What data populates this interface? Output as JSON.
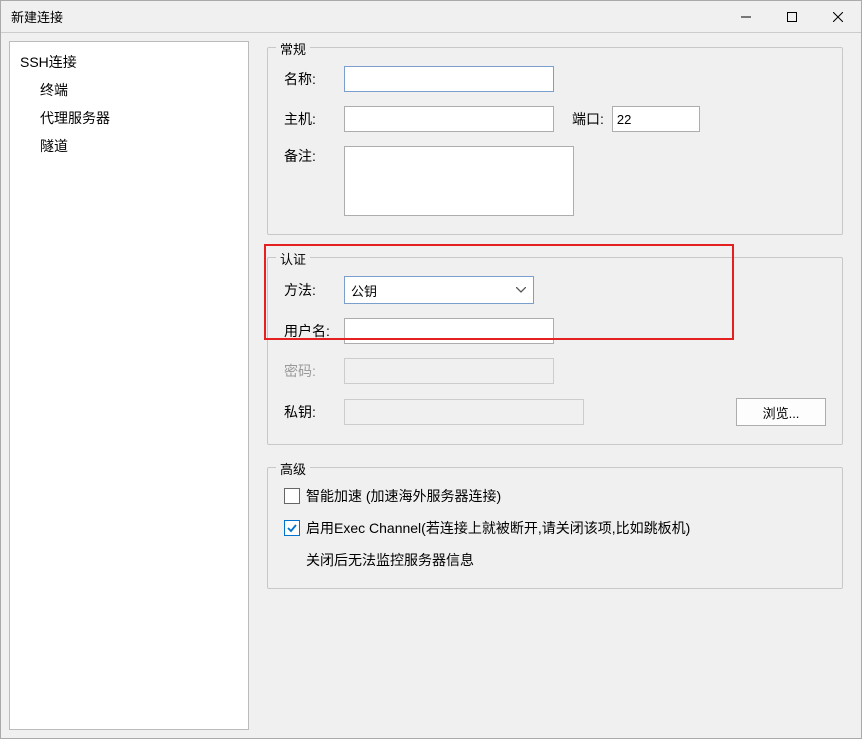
{
  "window": {
    "title": "新建连接"
  },
  "sidebar": {
    "items": [
      {
        "label": "SSH连接",
        "indent": "root",
        "selected": false
      },
      {
        "label": "终端",
        "indent": "child",
        "selected": false
      },
      {
        "label": "代理服务器",
        "indent": "child",
        "selected": false
      },
      {
        "label": "隧道",
        "indent": "child",
        "selected": false
      }
    ]
  },
  "general": {
    "legend": "常规",
    "name_label": "名称:",
    "name_value": "",
    "host_label": "主机:",
    "host_value": "",
    "port_label": "端口:",
    "port_value": "22",
    "remark_label": "备注:",
    "remark_value": ""
  },
  "auth": {
    "legend": "认证",
    "method_label": "方法:",
    "method_value": "公钥",
    "username_label": "用户名:",
    "username_value": "",
    "password_label": "密码:",
    "password_value": "",
    "privatekey_label": "私钥:",
    "privatekey_value": "",
    "browse_label": "浏览..."
  },
  "advanced": {
    "legend": "高级",
    "smart_accel_label": "智能加速 (加速海外服务器连接)",
    "smart_accel_checked": false,
    "exec_channel_label": "启用Exec Channel(若连接上就被断开,请关闭该项,比如跳板机)",
    "exec_channel_checked": true,
    "exec_note": "关闭后无法监控服务器信息"
  }
}
